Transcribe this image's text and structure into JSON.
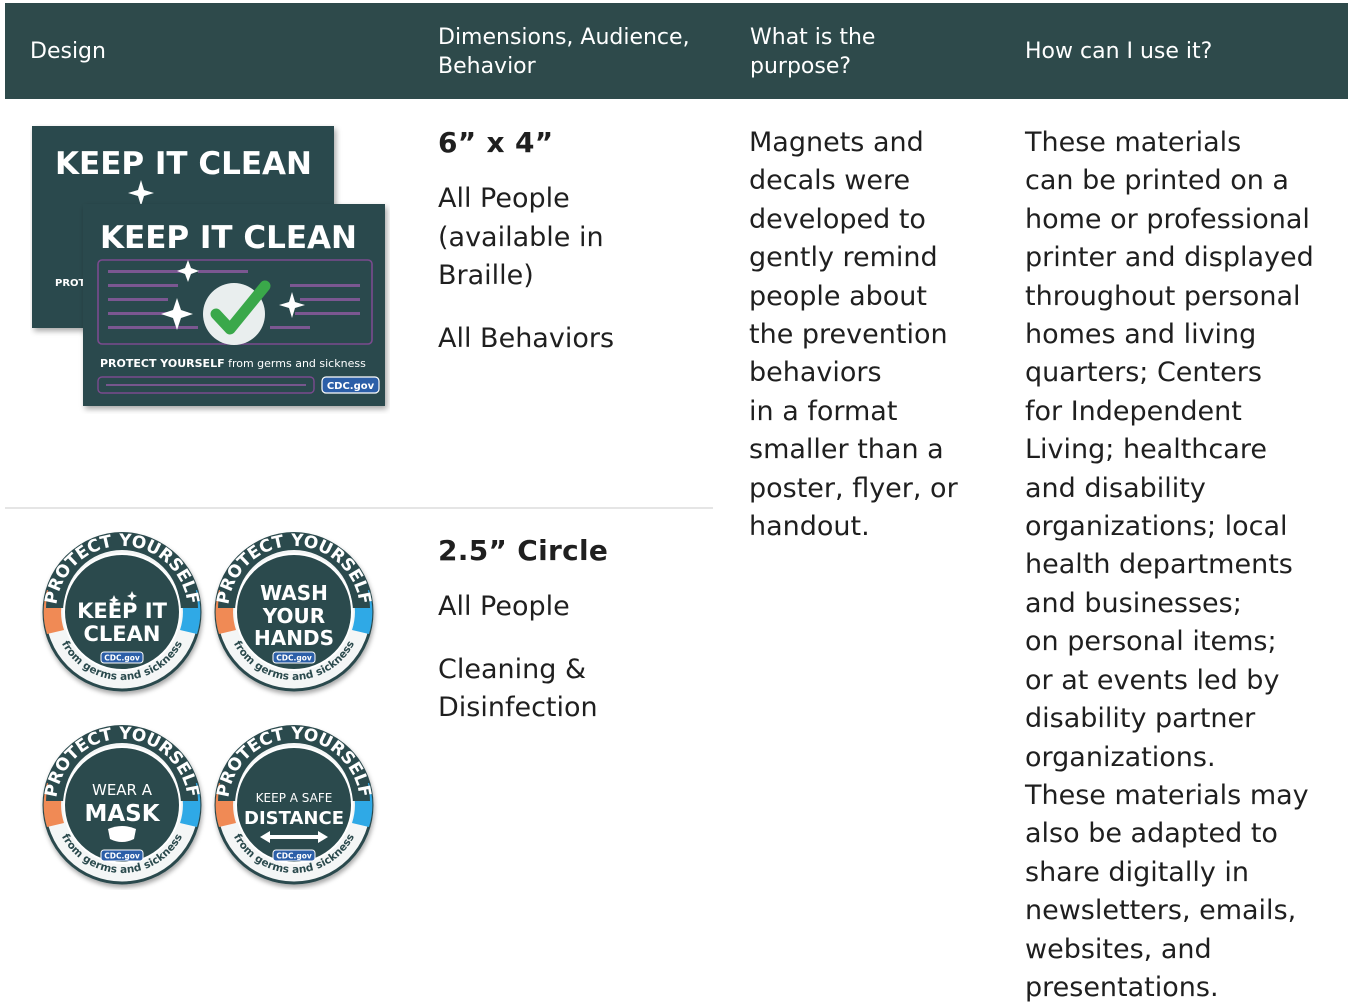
{
  "header": {
    "col_design": "Design",
    "col_dimensions": "Dimensions, Audience, Behavior",
    "col_purpose": "What is the purpose?",
    "col_use": "How can I use it?"
  },
  "rows": [
    {
      "size": "6” x 4”",
      "audience": "All People (available in Braille)",
      "behavior": "All Behaviors",
      "design_text": {
        "headline": "KEEP IT CLEAN",
        "back_partial": "PROT",
        "tagline_bold": "PROTECT YOURSELF",
        "tagline_rest": " from germs and sickness",
        "badge": "CDC.gov"
      }
    },
    {
      "size": "2.5” Circle",
      "audience": "All People",
      "behavior": "Cleaning & Disinfection",
      "design_text": {
        "ring_top": "PROTECT YOURSELF",
        "ring_bottom": "from germs and sickness",
        "badge": "CDC.gov",
        "stickers": [
          {
            "line1": "KEEP IT",
            "line2": "CLEAN"
          },
          {
            "line1": "WASH",
            "line2": "YOUR",
            "line3": "HANDS"
          },
          {
            "line1": "WEAR A",
            "line2": "MASK"
          },
          {
            "line1": "KEEP A SAFE",
            "line2": "DISTANCE"
          }
        ]
      }
    }
  ],
  "purpose_lines": [
    "Magnets and",
    "decals were",
    "developed to",
    "gently remind",
    "people about",
    "the prevention",
    "behaviors",
    "in a format",
    "smaller than a",
    "poster, flyer, or",
    "handout."
  ],
  "use_lines": [
    "These materials",
    "can be printed on a",
    "home or professional",
    "printer and displayed",
    "throughout personal",
    "homes and living",
    "quarters; Centers",
    "for Independent",
    "Living; healthcare",
    "and disability",
    "organizations; local",
    "health departments",
    "and businesses;",
    "on personal items;",
    "or at events led by",
    "disability partner",
    "organizations.",
    "These materials may",
    "also be adapted to",
    "share digitally in",
    "newsletters, emails,",
    "websites, and",
    "presentations."
  ],
  "colors": {
    "header_bg": "#2e4a4b",
    "card_bg": "#2b4a4d",
    "check_green": "#3aa84a",
    "accent_orange": "#f08a55",
    "accent_blue": "#2fa9e6",
    "badge_blue": "#2c5fa8",
    "braille_purple": "#7b4a8f"
  }
}
